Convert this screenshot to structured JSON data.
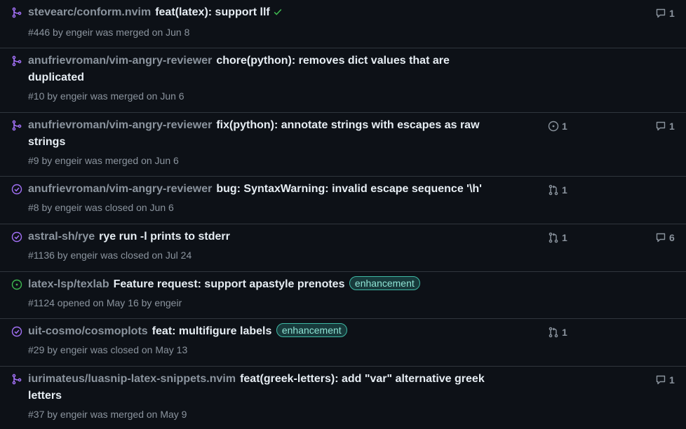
{
  "colors": {
    "merged": "#a371f7",
    "closed_done": "#a371f7",
    "open": "#3fb950",
    "muted": "#8b949e",
    "text": "#e6edf3",
    "border": "#30363d",
    "background": "#0d1117",
    "label_border": "#3fb9a5",
    "label_bg": "#173a3b",
    "label_text": "#8fe3d4"
  },
  "items": [
    {
      "status_icon": "pr-merged-icon",
      "repo": "stevearc/conform.nvim",
      "title": "feat(latex): support llf",
      "checks_icon": "check-icon",
      "meta": "#446 by engeir was merged on Jun 8",
      "comments": "1"
    },
    {
      "status_icon": "pr-merged-icon",
      "repo": "anufrievroman/vim-angry-reviewer",
      "title": "chore(python): removes dict values that are duplicated",
      "meta": "#10 by engeir was merged on Jun 6"
    },
    {
      "status_icon": "pr-merged-icon",
      "repo": "anufrievroman/vim-angry-reviewer",
      "title": "fix(python): annotate strings with escapes as raw strings",
      "meta": "#9 by engeir was merged on Jun 6",
      "linked_issues": "1",
      "comments": "1"
    },
    {
      "status_icon": "issue-closed-icon",
      "repo": "anufrievroman/vim-angry-reviewer",
      "title": "bug: SyntaxWarning: invalid escape sequence '\\h'",
      "meta": "#8 by engeir was closed on Jun 6",
      "linked_prs": "1"
    },
    {
      "status_icon": "issue-closed-icon",
      "repo": "astral-sh/rye",
      "title": "rye run -l prints to stderr",
      "meta": "#1136 by engeir was closed on Jul 24",
      "linked_prs": "1",
      "comments": "6"
    },
    {
      "status_icon": "issue-open-icon",
      "repo": "latex-lsp/texlab",
      "title": "Feature request: support apastyle prenotes",
      "label": "enhancement",
      "meta": "#1124 opened on May 16 by engeir"
    },
    {
      "status_icon": "issue-closed-icon",
      "repo": "uit-cosmo/cosmoplots",
      "title": "feat: multifigure labels",
      "label": "enhancement",
      "meta": "#29 by engeir was closed on May 13",
      "linked_prs": "1"
    },
    {
      "status_icon": "pr-merged-icon",
      "repo": "iurimateus/luasnip-latex-snippets.nvim",
      "title": "feat(greek-letters): add \"var\" alternative greek letters",
      "meta": "#37 by engeir was merged on May 9",
      "comments": "1"
    }
  ]
}
